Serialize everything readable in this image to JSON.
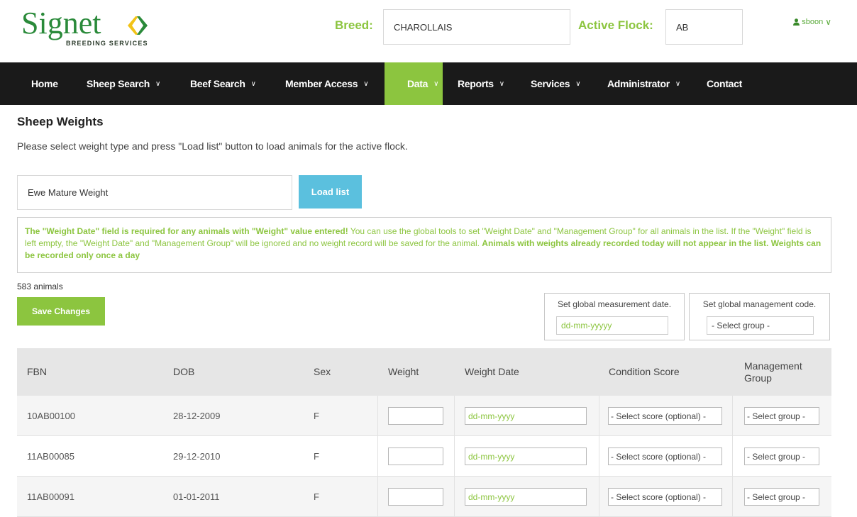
{
  "brand": {
    "name": "Signet",
    "subtitle": "BREEDING SERVICES",
    "colors": {
      "green": "#8cc53f",
      "dark_green": "#2a8a3a",
      "yellow": "#f2c318",
      "nav_bg": "#1a1a1a",
      "blue": "#5bc0de"
    }
  },
  "header": {
    "breed_label": "Breed:",
    "breed_value": "CHAROLLAIS",
    "flock_label": "Active Flock:",
    "flock_value": "AB",
    "user_icon": "user-icon",
    "username": "sboon",
    "user_chevron": "∨"
  },
  "nav": {
    "items": [
      {
        "label": "Home",
        "chevron": ""
      },
      {
        "label": "Sheep Search",
        "chevron": "∨"
      },
      {
        "label": "Beef Search",
        "chevron": "∨"
      },
      {
        "label": "Member Access",
        "chevron": "∨"
      },
      {
        "label": "Data",
        "chevron": "∨"
      },
      {
        "label": "Reports",
        "chevron": "∨"
      },
      {
        "label": "Services",
        "chevron": "∨"
      },
      {
        "label": "Administrator",
        "chevron": "∨"
      },
      {
        "label": "Contact",
        "chevron": ""
      }
    ]
  },
  "page": {
    "title": "Sheep Weights",
    "intro": "Please select weight type and press \"Load list\" button to load animals for the active flock.",
    "weight_type": "Ewe Mature Weight",
    "load_button": "Load list",
    "notice": {
      "part1": "The \"Weight Date\" field is required for any animals with \"Weight\" value entered!",
      "part2": " You can use the global tools to set \"Weight Date\" and \"Management Group\" for all animals in the list. If the \"Weight\" field is left empty, the \"Weight Date\" and \"Management Group\" will be ignored and no weight record will be saved for the animal. ",
      "part3": "Animals with weights already recorded today will not appear in the list. Weights can be recorded only once a day"
    },
    "count": "583 animals",
    "save_button": "Save Changes",
    "global_date": {
      "label": "Set global measurement date.",
      "placeholder": "dd-mm-yyyyy"
    },
    "global_group": {
      "label": "Set global management code.",
      "placeholder": "- Select group -"
    }
  },
  "table": {
    "headers": {
      "fbn": "FBN",
      "dob": "DOB",
      "sex": "Sex",
      "weight": "Weight",
      "weight_date": "Weight Date",
      "condition": "Condition Score",
      "group": "Management Group"
    },
    "rows": [
      {
        "fbn": "10AB00100",
        "dob": "28-12-2009",
        "sex": "F",
        "weight": "",
        "date_placeholder": "dd-mm-yyyy",
        "score": "- Select score (optional) -",
        "group": "- Select group -"
      },
      {
        "fbn": "11AB00085",
        "dob": "29-12-2010",
        "sex": "F",
        "weight": "",
        "date_placeholder": "dd-mm-yyyy",
        "score": "- Select score (optional) -",
        "group": "- Select group -"
      },
      {
        "fbn": "11AB00091",
        "dob": "01-01-2011",
        "sex": "F",
        "weight": "",
        "date_placeholder": "dd-mm-yyyy",
        "score": "- Select score (optional) -",
        "group": "- Select group -"
      }
    ]
  }
}
